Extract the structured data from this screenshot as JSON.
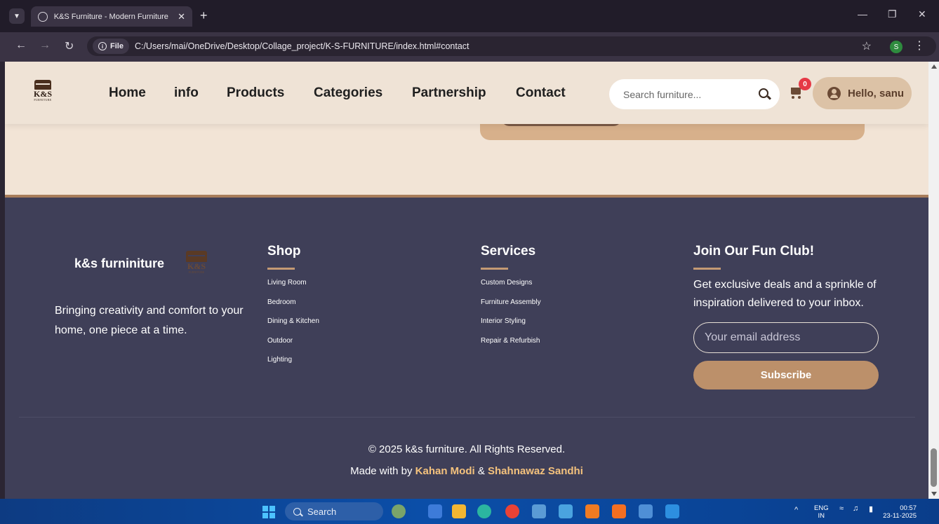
{
  "browser": {
    "tab_title": "K&S Furniture - Modern Furniture",
    "tab_close": "✕",
    "new_tab": "+",
    "file_chip": "File",
    "url": "C:/Users/mai/OneDrive/Desktop/Collage_project/K-S-FURNITURE/index.html#contact",
    "profile_initial": "S"
  },
  "header": {
    "logo_text": "K&S",
    "logo_sub": "FURNITURE",
    "nav": [
      "Home",
      "info",
      "Products",
      "Categories",
      "Partnership",
      "Contact"
    ],
    "search_placeholder": "Search furniture...",
    "cart_count": "0",
    "user_label": "Hello, sanu"
  },
  "footer": {
    "brand": "k&s furniniture",
    "logo_text": "K&S",
    "logo_sub": "FURNITURE",
    "tagline": "Bringing creativity and comfort to your home, one piece at a time.",
    "shop": {
      "title": "Shop",
      "items": [
        "Living Room",
        "Bedroom",
        "Dining & Kitchen",
        "Outdoor",
        "Lighting"
      ]
    },
    "services": {
      "title": "Services",
      "items": [
        "Custom Designs",
        "Furniture Assembly",
        "Interior Styling",
        "Repair & Refurbish"
      ]
    },
    "club": {
      "title": "Join Our Fun Club!",
      "text": "Get exclusive deals and a sprinkle of inspiration delivered to your inbox.",
      "email_placeholder": "Your email address",
      "subscribe_label": "Subscribe"
    },
    "copyright": "© 2025 k&s furniture. All Rights Reserved.",
    "made_with": "Made with by",
    "author1": "Kahan Modi",
    "amp": "&",
    "author2": "Shahnawaz Sandhi"
  },
  "taskbar": {
    "search_label": "Search",
    "lang_top": "ENG",
    "lang_bottom": "IN",
    "time": "00:57",
    "date": "23-11-2025"
  },
  "colors": {
    "header_bg": "#efe3d6",
    "footer_bg": "#3f3f58",
    "accent_brown": "#bc906a",
    "author_highlight": "#f4c27d",
    "badge_red": "#e63946"
  }
}
